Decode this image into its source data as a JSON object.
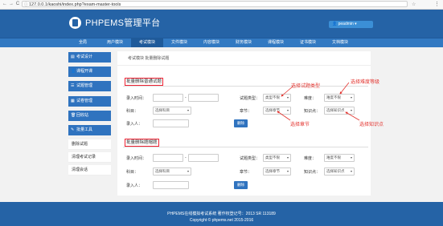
{
  "browser": {
    "url": "127.0.0.1/kaoshi/index.php?exam-master-tools",
    "back": "←",
    "forward": "→",
    "reload": "C",
    "info_icon": "ⓘ",
    "star_icon": "☆",
    "menu_icon": "⋮"
  },
  "header": {
    "brand": "PHPEMS管理平台",
    "user_label": "👤 peadmin ▾"
  },
  "nav": {
    "items": [
      "全局",
      "用户模块",
      "考试模块",
      "文件模块",
      "内容模块",
      "财务模块",
      "课程模块",
      "证书模块",
      "文档模块"
    ],
    "active_index": 2
  },
  "sidebar": {
    "items": [
      {
        "label": "考试设计",
        "icon": "▤"
      },
      {
        "label": "课程开课",
        "icon": "👤"
      },
      {
        "label": "试题管理",
        "icon": "☰"
      },
      {
        "label": "试卷管理",
        "icon": "▦"
      },
      {
        "label": "回收站",
        "icon": "🗑"
      },
      {
        "label": "批量工具",
        "icon": "✎"
      }
    ],
    "subitems": [
      "删除试题",
      "清理考试记录",
      "清理会话"
    ]
  },
  "breadcrumb": "考试模块    批量删除试题",
  "section1": {
    "title": "批量删除普通试题",
    "entry_time_label": "录入时间：",
    "subject_label": "科目：",
    "subject_placeholder": "选择科目",
    "entrant_label": "录入人：",
    "type_label": "试题类型：",
    "type_value": "类型不限",
    "difficulty_label": "难度：",
    "difficulty_value": "难度不限",
    "chapter_label": "章节：",
    "chapter_value": "选择章节",
    "knowledge_label": "知识点：",
    "knowledge_value": "选择知识点",
    "delete_button": "删除"
  },
  "section2": {
    "title": "批量删除题帽题",
    "entry_time_label": "录入时间：",
    "subject_label": "科目：",
    "subject_placeholder": "选择科目",
    "entrant_label": "录入人：",
    "type_label": "试题类型：",
    "type_value": "类型不限",
    "difficulty_label": "难度：",
    "difficulty_value": "难度不限",
    "chapter_label": "章节：",
    "chapter_value": "选择章节",
    "knowledge_label": "知识点：",
    "knowledge_value": "选择知识点",
    "delete_button": "删除"
  },
  "annotations": {
    "select_type": "选择试题类型",
    "select_difficulty": "选择难度等级",
    "select_chapter": "选择章节",
    "select_knowledge": "选择知识点",
    "color": "#e3342f"
  },
  "footer": {
    "line1": "PHPEMS在线模拟考试系统 著作权登记号：2013 SR 113189",
    "line2": "Copyright © phpems.net 2015-2016"
  },
  "colors": {
    "header": "#2563a6",
    "nav": "#3279c2",
    "sidebar": "#2f73bf"
  }
}
